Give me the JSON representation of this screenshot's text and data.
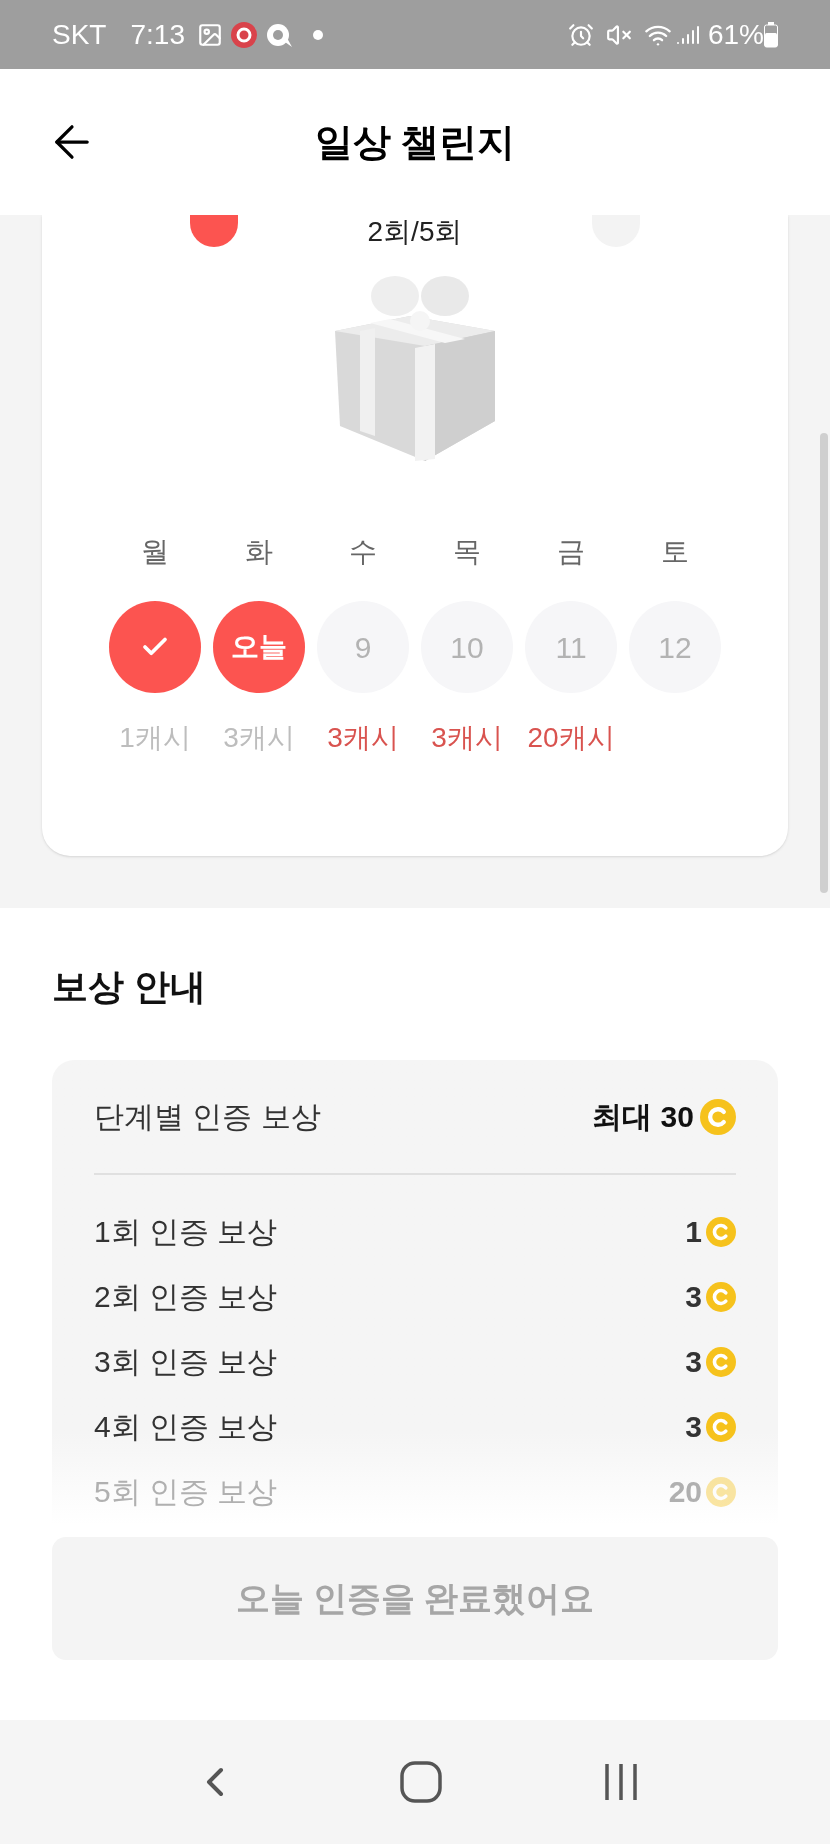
{
  "status_bar": {
    "carrier": "SKT",
    "time": "7:13",
    "battery": "61%"
  },
  "header": {
    "title": "일상 챌린지"
  },
  "challenge": {
    "progress": "2회/5회",
    "days": [
      {
        "weekday": "월",
        "kind": "done",
        "cash": "1캐시"
      },
      {
        "weekday": "화",
        "kind": "today",
        "label": "오늘",
        "cash": "3캐시"
      },
      {
        "weekday": "수",
        "kind": "upcoming",
        "label": "9",
        "cash": "3캐시"
      },
      {
        "weekday": "목",
        "kind": "upcoming",
        "label": "10",
        "cash": "3캐시"
      },
      {
        "weekday": "금",
        "kind": "upcoming",
        "label": "11",
        "cash": "20캐시"
      },
      {
        "weekday": "토",
        "kind": "upcoming",
        "label": "12"
      }
    ]
  },
  "rewards": {
    "title": "보상 안내",
    "summary": {
      "label": "단계별 인증 보상",
      "value": "최대 30"
    },
    "rows": [
      {
        "label": "1회 인증 보상",
        "value": "1",
        "faded": false
      },
      {
        "label": "2회 인증 보상",
        "value": "3",
        "faded": false
      },
      {
        "label": "3회 인증 보상",
        "value": "3",
        "faded": false
      },
      {
        "label": "4회 인증 보상",
        "value": "3",
        "faded": false
      },
      {
        "label": "5회 인증 보상",
        "value": "20",
        "faded": true
      }
    ]
  },
  "action_button": {
    "label": "오늘 인증을 완료했어요",
    "disabled": true
  }
}
